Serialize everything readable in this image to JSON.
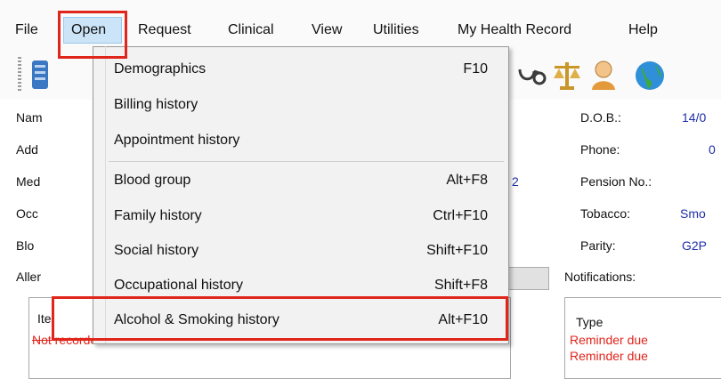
{
  "menubar": {
    "items": [
      "File",
      "Open",
      "Request",
      "Clinical",
      "View",
      "Utilities",
      "My Health Record",
      "Help"
    ]
  },
  "patient": {
    "left_labels": [
      "Nam",
      "Add",
      "Med",
      "Occ",
      "Blo",
      "Aller"
    ],
    "mid_link": "2",
    "right_labels": [
      "D.O.B.:",
      "Phone:",
      "Pension No.:",
      "Tobacco:",
      "Parity:"
    ],
    "right_values": [
      "14/0",
      "0",
      "",
      "Smo",
      "G2P"
    ],
    "notifications_label": "Notifications:"
  },
  "left_panel": {
    "col_header": "Ite",
    "row1": "Not recorded"
  },
  "right_panel": {
    "col_header": "Type",
    "rows": [
      "Reminder due",
      "Reminder due"
    ]
  },
  "open_menu": {
    "items": [
      {
        "label": "Demographics",
        "shortcut": "F10"
      },
      {
        "label": "Billing history",
        "shortcut": ""
      },
      {
        "label": "Appointment history",
        "shortcut": ""
      },
      {
        "label": "Blood group",
        "shortcut": "Alt+F8"
      },
      {
        "label": "Family history",
        "shortcut": "Ctrl+F10"
      },
      {
        "label": "Social history",
        "shortcut": "Shift+F10"
      },
      {
        "label": "Occupational history",
        "shortcut": "Shift+F8"
      },
      {
        "label": "Alcohol & Smoking history",
        "shortcut": "Alt+F10"
      }
    ]
  },
  "colors": {
    "highlight_box": "#e0251b",
    "menu_hover": "#cce4f7",
    "link_blue": "#1d2fa8"
  },
  "toolbar_icons": [
    "database-icon",
    "stethoscope-icon",
    "scales-icon",
    "person-icon",
    "globe-icon"
  ]
}
